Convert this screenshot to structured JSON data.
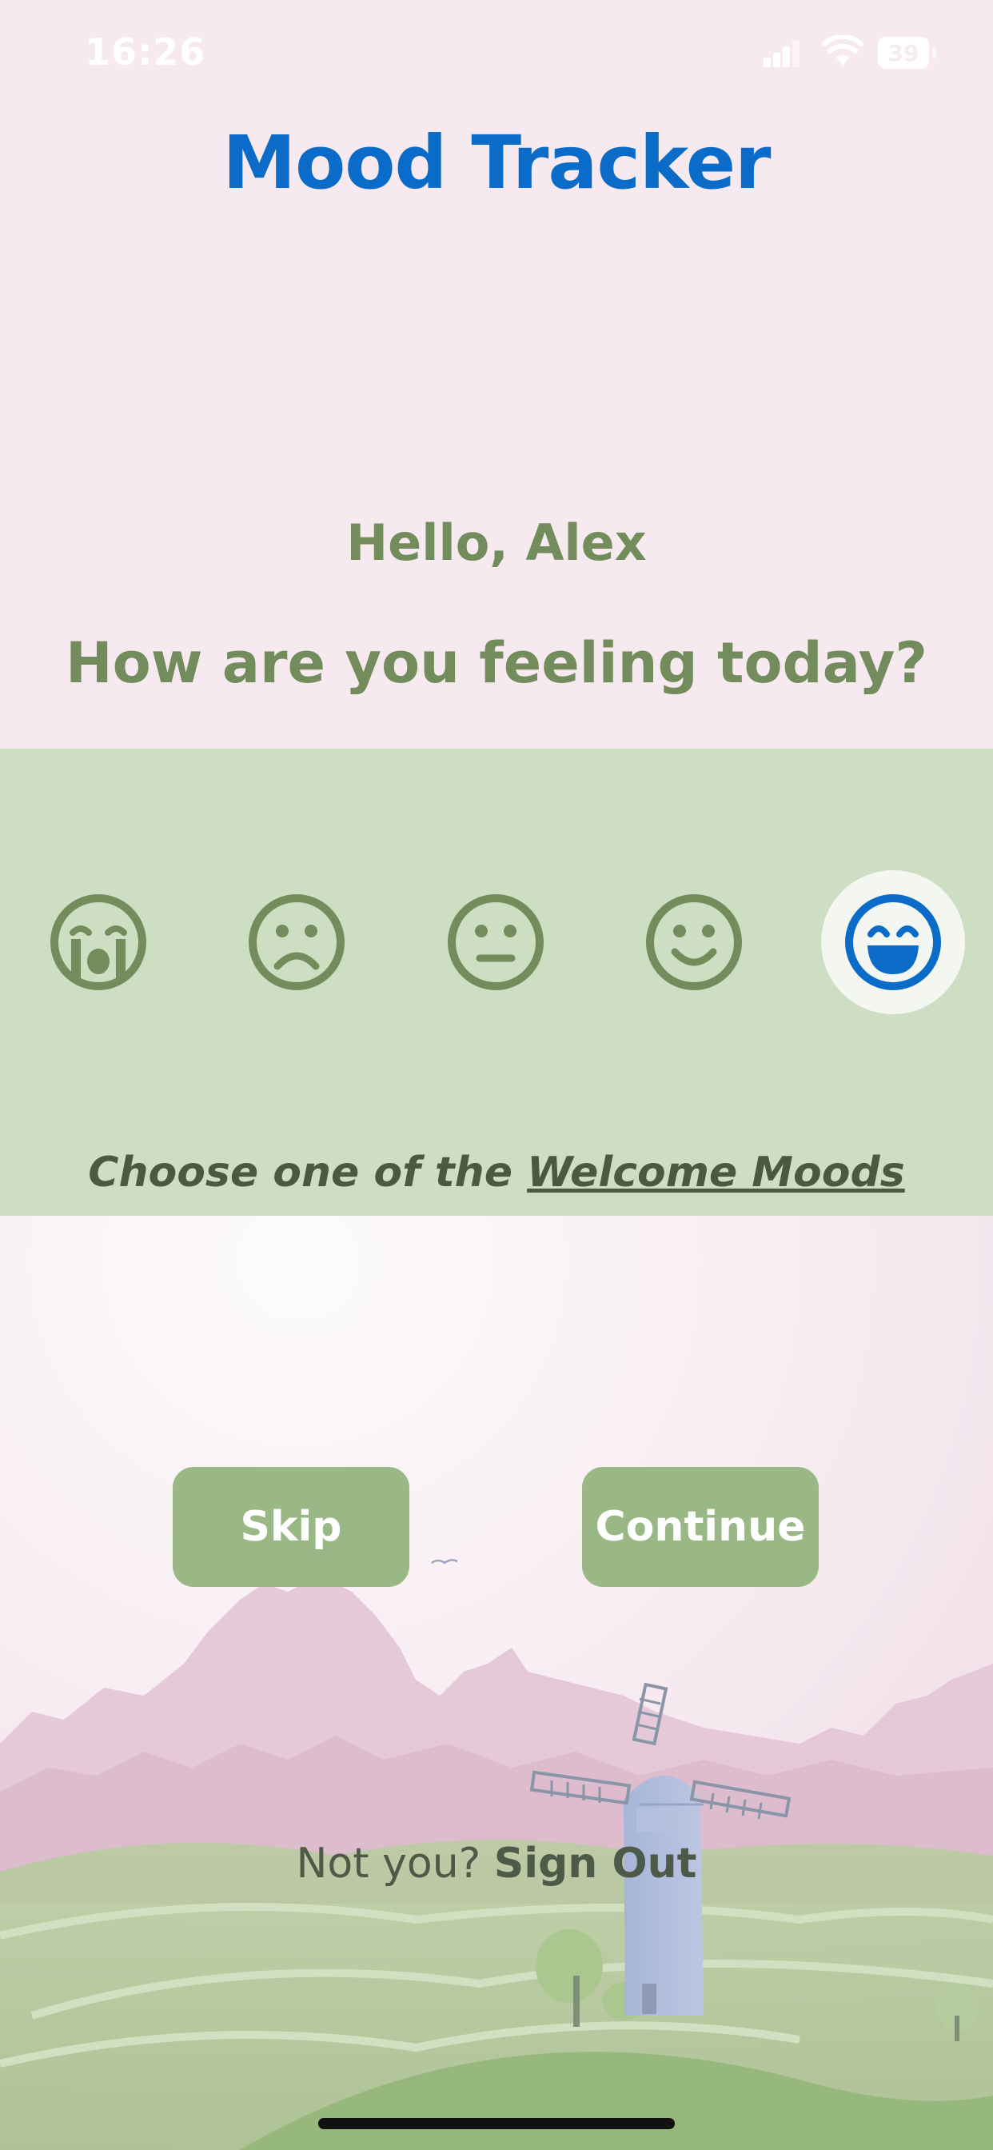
{
  "status_bar": {
    "time": "16:26",
    "battery": "39"
  },
  "header": {
    "title": "Mood Tracker"
  },
  "greeting": {
    "hello": "Hello, Alex",
    "question": "How are you feeling today?"
  },
  "moods": [
    {
      "icon": "crying-face-icon",
      "selected": false
    },
    {
      "icon": "sad-face-icon",
      "selected": false
    },
    {
      "icon": "neutral-face-icon",
      "selected": false
    },
    {
      "icon": "smiling-face-icon",
      "selected": false
    },
    {
      "icon": "laughing-face-icon",
      "selected": true
    }
  ],
  "mood_hint": {
    "prefix": "Choose one of the ",
    "link": "Welcome Moods"
  },
  "actions": {
    "skip_label": "Skip",
    "continue_label": "Continue"
  },
  "footer": {
    "prompt": "Not you? ",
    "sign_out_label": "Sign Out"
  },
  "colors": {
    "title_blue": "#0a6cc8",
    "text_green": "#728c5c",
    "band_green": "#cddec3",
    "button_green": "#9ab885",
    "background_pink": "#f6eaf0"
  }
}
